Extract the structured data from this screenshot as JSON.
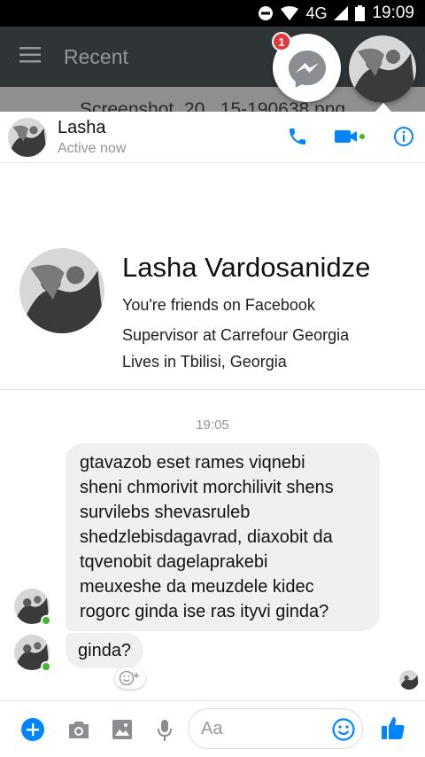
{
  "status_bar": {
    "time": "19:09",
    "network": "4G"
  },
  "background_app": {
    "title": "Recent",
    "filename": "Screenshot_20...15-190638.png"
  },
  "chat_heads": {
    "badge_count": "1"
  },
  "header": {
    "name": "Lasha",
    "status": "Active now"
  },
  "profile": {
    "full_name": "Lasha Vardosanidze",
    "friendship": "You're friends on Facebook",
    "work": "Supervisor at Carrefour Georgia",
    "location": "Lives in Tbilisi, Georgia"
  },
  "conversation": {
    "timestamp": "19:05",
    "messages": [
      {
        "lines": [
          "gtavazob eset rames viqnebi",
          "sheni chmorivit morchilivit shens",
          "survilebs shevasruleb",
          "shedzlebisdagavrad, diaxobit da",
          "tqvenobit dagelaprakebi",
          "meuxeshe da meuzdele kidec",
          "rogorc ginda ise ras ityvi ginda?"
        ]
      },
      {
        "text": "ginda?"
      }
    ]
  },
  "composer": {
    "placeholder": "Aa"
  },
  "colors": {
    "accent": "#0084ff",
    "bubble": "#f1f0f0",
    "online": "#42b72a",
    "badge": "#e0393e"
  }
}
